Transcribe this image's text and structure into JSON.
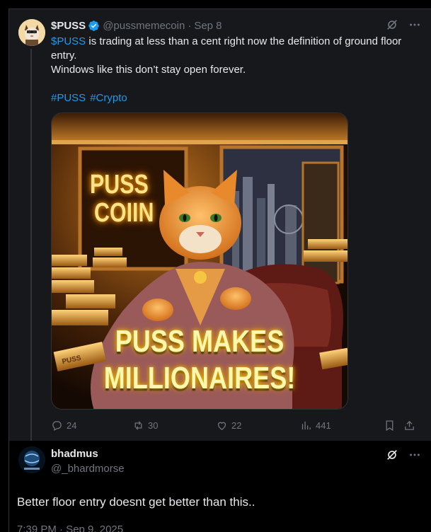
{
  "tweet1": {
    "display_name": "$PUSS",
    "handle": "@pussmemecoin",
    "separator": "·",
    "date": "Sep 8",
    "text_mention": "$PUSS",
    "text_rest_line1": " is trading at less than a cent right now the definition of ground floor entry.",
    "text_line2": "Windows like this don’t stay open forever.",
    "hashtags": [
      "#PUSS",
      "#Crypto"
    ],
    "media": {
      "sign_line1": "PUSS",
      "sign_line2": "COIIN",
      "caption_line1": "PUSS MAKES",
      "caption_line2": "MILLIONAIRES!",
      "gold_bar_label": "PUSS"
    },
    "counts": {
      "replies": "24",
      "reposts": "30",
      "likes": "22",
      "views": "441"
    }
  },
  "tweet2": {
    "display_name": "bhadmus",
    "handle": "@_bhardmorse",
    "text": "Better floor entry doesnt get better than this..",
    "timestamp": "7:39 PM · Sep 9, 2025"
  },
  "colors": {
    "accent_link": "#1d9bf0",
    "muted": "#71767b",
    "text": "#e7e9ea",
    "tweet1_bg": "#16181c",
    "page_bg": "#000000"
  },
  "icons": {
    "verified": "verified-badge-icon",
    "grok": "grok-icon",
    "more": "more-icon",
    "reply": "reply-icon",
    "repost": "repost-icon",
    "like": "like-icon",
    "views": "views-icon",
    "bookmark": "bookmark-icon",
    "share": "share-icon"
  }
}
